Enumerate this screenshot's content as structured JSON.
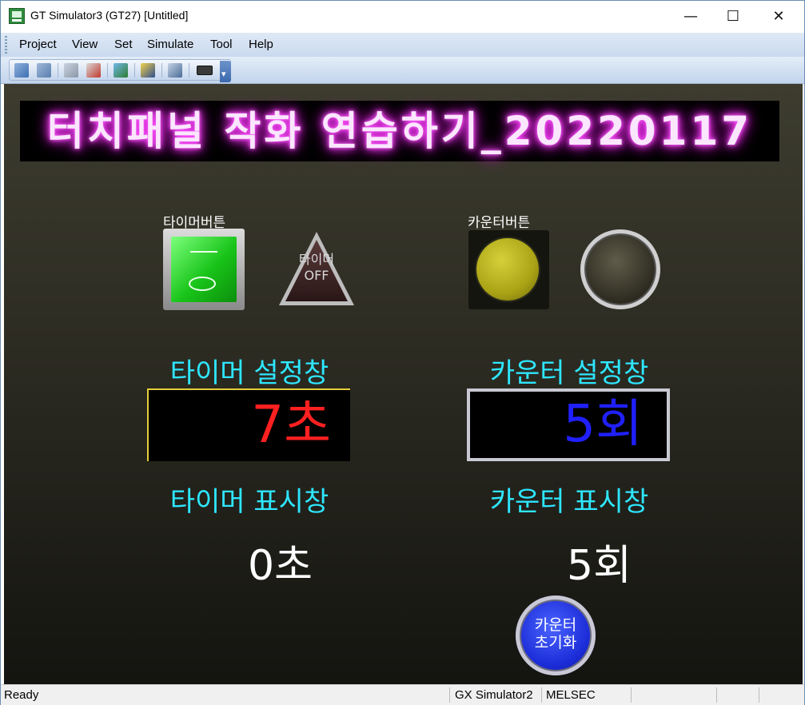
{
  "window": {
    "title": "GT Simulator3 (GT27)  [Untitled]",
    "controls": {
      "minimize": "—",
      "maximize": "☐",
      "close": "✕"
    }
  },
  "menu": [
    "Project",
    "View",
    "Set",
    "Simulate",
    "Tool",
    "Help"
  ],
  "toolbar": {
    "icons": [
      "reload-icon",
      "open-icon",
      "step-icon",
      "monitor-icon",
      "device-monitor-icon",
      "refresh-icon",
      "search-device-icon",
      "keyboard-icon"
    ]
  },
  "screen": {
    "banner": "터치패널 작화 연습하기_20220117",
    "timer_button_label": "타이머버튼",
    "timer_lamp_text": [
      "타이머",
      "OFF"
    ],
    "counter_button_label": "카운터버튼",
    "timer_setting_label": "타이머 설정창",
    "counter_setting_label": "카운터 설정창",
    "timer_setting_value": "7초",
    "counter_setting_value": "5회",
    "timer_display_label": "타이머 표시창",
    "counter_display_label": "카운터 표시창",
    "timer_display_value": "0초",
    "counter_display_value": "5회",
    "reset_button_text": [
      "카운터",
      "초기화"
    ],
    "colors": {
      "label_cyan": "#2ee6ff",
      "timer_value_red": "#ff2020",
      "counter_value_blue": "#2020ff",
      "switch_green": "#19c419",
      "button_yellow": "#aaa315",
      "reset_blue": "#1a2bd6"
    }
  },
  "status": {
    "left": "Ready",
    "simulator": "GX Simulator2",
    "plc": "MELSEC"
  }
}
